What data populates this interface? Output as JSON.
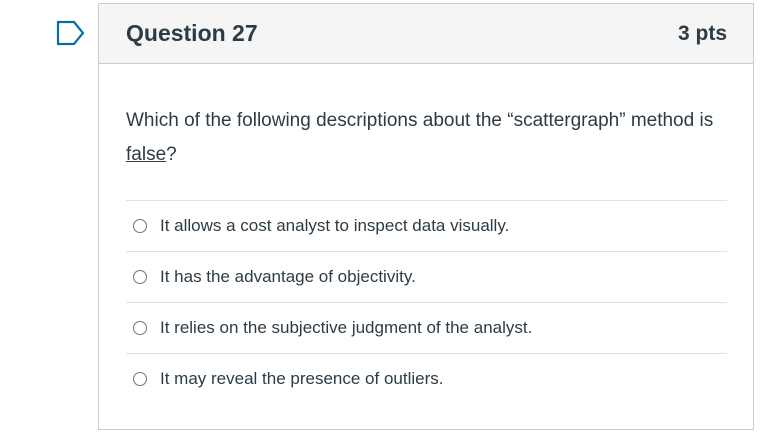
{
  "question": {
    "title": "Question 27",
    "points": "3 pts",
    "text_before": "Which of the following descriptions about the “scattergraph” method is ",
    "text_underlined": "false",
    "text_after": "?",
    "answers": [
      {
        "label": "It allows a cost analyst to inspect data visually."
      },
      {
        "label": "It has the advantage of objectivity."
      },
      {
        "label": "It relies on the subjective judgment of the analyst."
      },
      {
        "label": "It may reveal the presence of outliers."
      }
    ]
  },
  "colors": {
    "header_bg": "#f5f5f5",
    "border": "#c7cdd1",
    "text": "#2d3b45",
    "flag": "#0770a3"
  },
  "icons": {
    "flag": "flag-question-icon",
    "radio": "radio-unselected-icon"
  }
}
